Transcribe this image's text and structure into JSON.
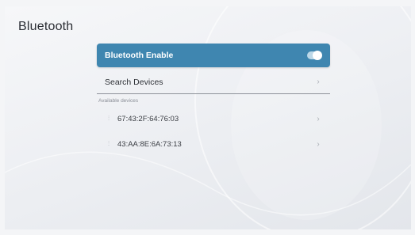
{
  "page": {
    "title": "Bluetooth"
  },
  "bluetooth_enable": {
    "label": "Bluetooth Enable",
    "enabled": true
  },
  "search_devices": {
    "label": "Search Devices",
    "chevron_icon": "chevron-right-icon"
  },
  "available": {
    "header": "Available devices",
    "devices": [
      {
        "address": "67:43:2F:64:76:03",
        "icon": "device-icon"
      },
      {
        "address": "43:AA:8E:6A:73:13",
        "icon": "device-icon"
      }
    ]
  },
  "colors": {
    "accent": "#3f86b0",
    "background": "#f4f5f7"
  }
}
